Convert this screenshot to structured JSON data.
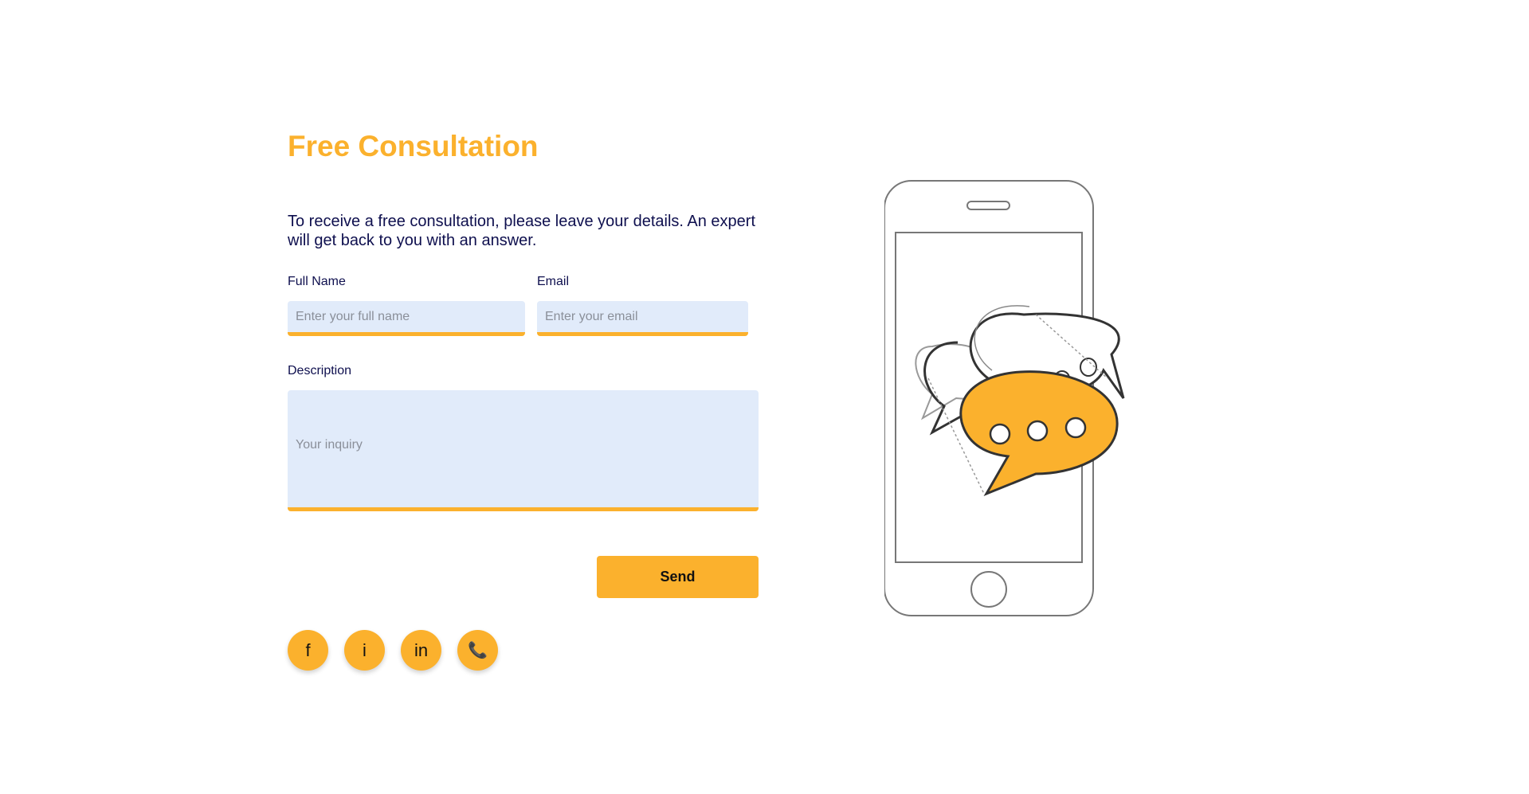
{
  "form": {
    "title": "Free Consultation",
    "intro": "To receive a free consultation, please leave your details. An expert will get back to you with an answer.",
    "full_name": {
      "label": "Full Name",
      "placeholder": "Enter your full name",
      "value": ""
    },
    "email": {
      "label": "Email",
      "placeholder": "Enter your email",
      "value": ""
    },
    "description": {
      "label": "Description",
      "placeholder": "Your inquiry",
      "value": ""
    },
    "send_label": "Send"
  },
  "socials": [
    {
      "icon": "facebook-icon",
      "glyph": "f"
    },
    {
      "icon": "instagram-icon",
      "glyph": "i"
    },
    {
      "icon": "linkedin-icon",
      "glyph": "in"
    },
    {
      "icon": "phone-icon",
      "glyph": "📞"
    }
  ],
  "colors": {
    "accent": "#fbb12d",
    "text": "#0e0f4e",
    "field_bg": "#e1ebfa"
  }
}
